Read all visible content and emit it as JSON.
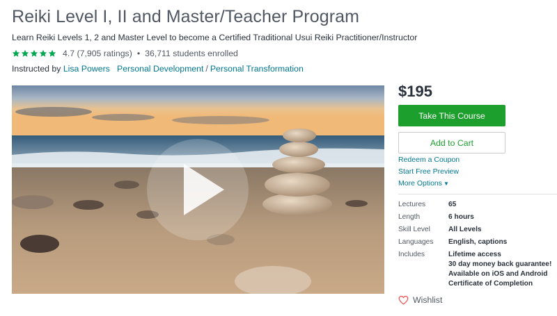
{
  "course": {
    "title": "Reiki Level I, II and Master/Teacher Program",
    "subtitle": "Learn Reiki Levels 1, 2 and Master Level to become a Certified Traditional Usui Reiki Practitioner/Instructor",
    "rating_value": 4.7,
    "rating_text": "4.7 (7,905 ratings)",
    "separator": "•",
    "enrolled_text": "36,711 students enrolled",
    "instructed_by_label": "Instructed by",
    "instructor": "Lisa Powers",
    "category_1": "Personal Development",
    "category_sep": "/",
    "category_2": "Personal Transformation"
  },
  "purchase": {
    "price": "$195",
    "take_course_label": "Take This Course",
    "add_to_cart_label": "Add to Cart",
    "redeem_label": "Redeem a Coupon",
    "preview_label": "Start Free Preview",
    "more_options_label": "More Options",
    "wishlist_label": "Wishlist"
  },
  "specs": {
    "lectures_label": "Lectures",
    "lectures_value": "65",
    "length_label": "Length",
    "length_value": "6 hours",
    "skill_label": "Skill Level",
    "skill_value": "All Levels",
    "languages_label": "Languages",
    "languages_value": "English, captions",
    "includes_label": "Includes",
    "includes": [
      "Lifetime access",
      "30 day money back guarantee!",
      "Available on iOS and Android",
      "Certificate of Completion"
    ]
  },
  "colors": {
    "star": "#00a650",
    "accent_green": "#1d9f2d",
    "link": "#007791",
    "wishlist_heart": "#ec5252"
  },
  "icons": {
    "star": "star-icon",
    "play": "play-icon",
    "caret": "caret-down-icon",
    "heart": "heart-outline-icon"
  }
}
